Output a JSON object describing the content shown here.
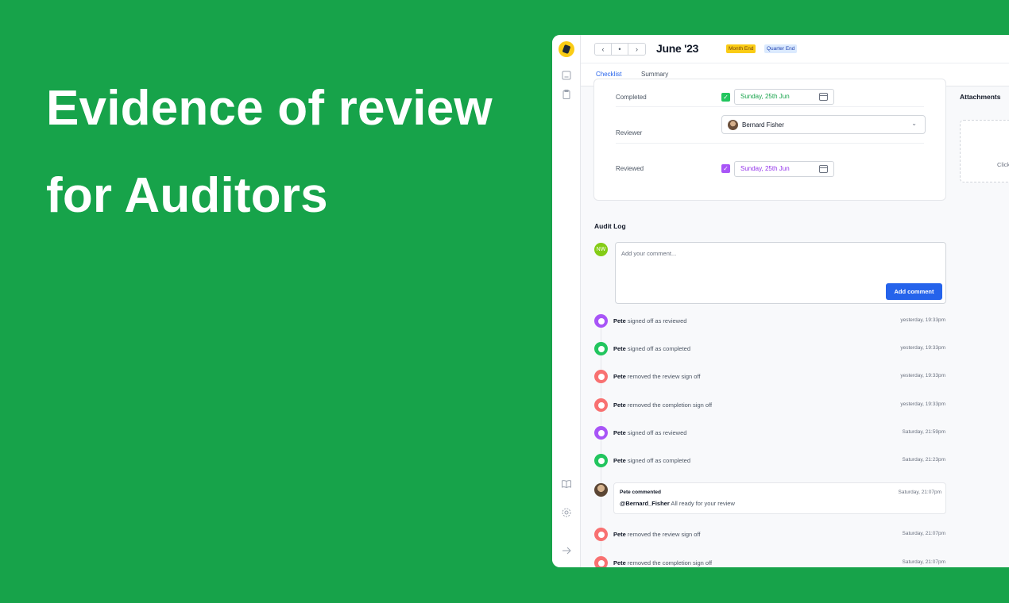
{
  "hero": {
    "line1": "Evidence of review",
    "line2": "for Auditors"
  },
  "header": {
    "prev": "‹",
    "today": "•",
    "next": "›",
    "period": "June '23",
    "tags": [
      "Month End",
      "Quarter End"
    ]
  },
  "tabs": [
    "Checklist",
    "Summary"
  ],
  "active_tab": "Checklist",
  "signoff": {
    "completed_label": "Completed",
    "completed_date": "Sunday, 25th Jun",
    "reviewer_label": "Reviewer",
    "reviewer_name": "Bernard Fisher",
    "reviewed_label": "Reviewed",
    "reviewed_date": "Sunday, 25th Jun"
  },
  "attachments": {
    "title": "Attachments",
    "hint": "Click"
  },
  "audit": {
    "title": "Audit Log",
    "my_initials": "NW",
    "comment_placeholder": "Add your comment...",
    "add_button": "Add comment",
    "entries": [
      {
        "user": "Pete",
        "action": " signed off as reviewed",
        "time": "yesterday, 19:33pm"
      },
      {
        "user": "Pete",
        "action": " signed off as completed",
        "time": "yesterday, 19:33pm"
      },
      {
        "user": "Pete",
        "action": " removed the review sign off",
        "time": "yesterday, 19:33pm"
      },
      {
        "user": "Pete",
        "action": " removed the completion sign off",
        "time": "yesterday, 19:33pm"
      },
      {
        "user": "Pete",
        "action": " signed off as reviewed",
        "time": "Saturday, 21:59pm"
      },
      {
        "user": "Pete",
        "action": " signed off as completed",
        "time": "Saturday, 21:23pm"
      },
      {
        "user": "Pete",
        "action": " removed the review sign off",
        "time": "Saturday, 21:07pm"
      },
      {
        "user": "Pete",
        "action": " removed the completion sign off",
        "time": "Saturday, 21:07pm"
      }
    ],
    "comment": {
      "author": "Pete commented",
      "time": "Saturday, 21:07pm",
      "mention": "@Bernard_Fisher",
      "text": " All ready for your review"
    }
  },
  "colors": {
    "background": "#17a34a",
    "accent": "#2563eb",
    "reviewed": "#a855f7",
    "completed": "#22c55e",
    "removed": "#f87171"
  },
  "icons": {
    "logo": "bee-logo-icon",
    "rail": [
      "book-icon",
      "clipboard-icon",
      "open-book-icon",
      "gear-icon",
      "arrow-right-icon"
    ]
  }
}
